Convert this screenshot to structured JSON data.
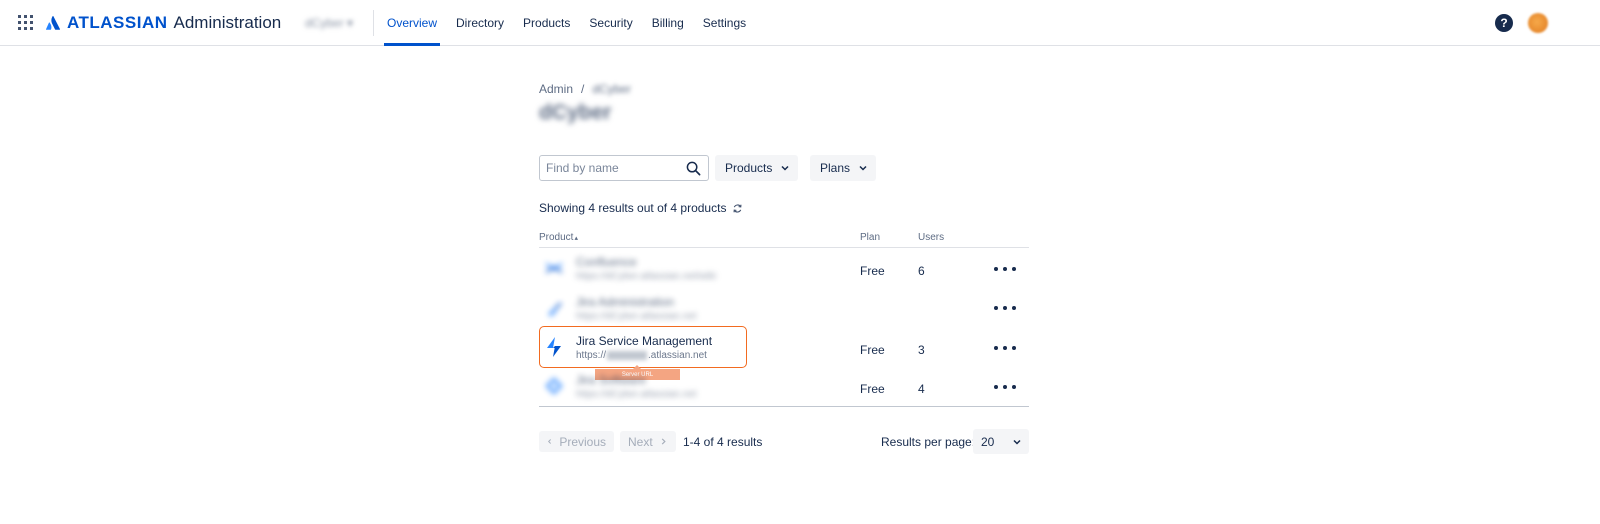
{
  "header": {
    "brand_name": "ATLASSIAN",
    "brand_sub": "Administration",
    "org_switcher": "dCyber",
    "nav": [
      {
        "label": "Overview",
        "active": true
      },
      {
        "label": "Directory"
      },
      {
        "label": "Products"
      },
      {
        "label": "Security"
      },
      {
        "label": "Billing"
      },
      {
        "label": "Settings"
      }
    ],
    "help_glyph": "?"
  },
  "breadcrumb": {
    "root": "Admin",
    "separator": "/",
    "current": "dCyber"
  },
  "page_title": "dCyber",
  "filters": {
    "search_placeholder": "Find by name",
    "products_label": "Products",
    "plans_label": "Plans"
  },
  "summary": "Showing 4 results out of 4 products",
  "table": {
    "headers": {
      "product": "Product",
      "sort_glyph": "▴",
      "plan": "Plan",
      "users": "Users"
    },
    "rows": [
      {
        "name": "Confluence",
        "url": "https://dCyber.atlassian.net/wiki",
        "plan": "Free",
        "users": "6",
        "icon": "confluence-icon"
      },
      {
        "name": "Jira Administration",
        "url": "https://dCyber.atlassian.net",
        "plan": "",
        "users": "",
        "icon": "jira-admin-icon"
      },
      {
        "name": "Jira Service Management",
        "url_prefix": "https://",
        "url_suffix": ".atlassian.net",
        "plan": "Free",
        "users": "3",
        "icon": "jira-service-management-icon"
      },
      {
        "name": "Jira Software",
        "url": "https://dCyber.atlassian.net",
        "plan": "Free",
        "users": "4",
        "icon": "jira-software-icon"
      }
    ]
  },
  "annotation": {
    "tooltip": "Server URL"
  },
  "pagination": {
    "previous": "Previous",
    "next": "Next",
    "info": "1-4 of 4 results",
    "per_page_label": "Results per page:",
    "per_page_value": "20"
  },
  "colors": {
    "accent": "#0052cc",
    "highlight": "#f26b20",
    "tooltip_bg": "#f4a582"
  }
}
